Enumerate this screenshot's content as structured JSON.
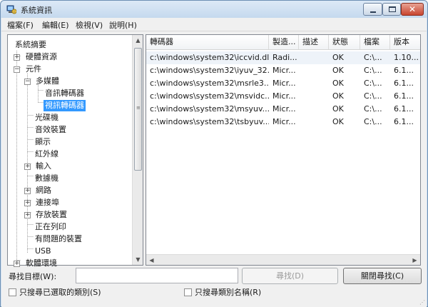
{
  "window": {
    "title": "系統資訊"
  },
  "menu": [
    {
      "label": "檔案(F)"
    },
    {
      "label": "編輯(E)"
    },
    {
      "label": "檢視(V)"
    },
    {
      "label": "說明(H)"
    }
  ],
  "tree": [
    {
      "label": "系統摘要",
      "level": 0,
      "toggle": ""
    },
    {
      "label": "硬體資源",
      "level": 1,
      "toggle": "+"
    },
    {
      "label": "元件",
      "level": 1,
      "toggle": "−"
    },
    {
      "label": "多媒體",
      "level": 2,
      "toggle": "−"
    },
    {
      "label": "音訊轉碼器",
      "level": 3,
      "toggle": ""
    },
    {
      "label": "視訊轉碼器",
      "level": 3,
      "toggle": "",
      "selected": true
    },
    {
      "label": "光碟機",
      "level": 2,
      "toggle": ""
    },
    {
      "label": "音效裝置",
      "level": 2,
      "toggle": ""
    },
    {
      "label": "顯示",
      "level": 2,
      "toggle": ""
    },
    {
      "label": "紅外線",
      "level": 2,
      "toggle": ""
    },
    {
      "label": "輸入",
      "level": 2,
      "toggle": "+"
    },
    {
      "label": "數據機",
      "level": 2,
      "toggle": ""
    },
    {
      "label": "網路",
      "level": 2,
      "toggle": "+"
    },
    {
      "label": "連接埠",
      "level": 2,
      "toggle": "+"
    },
    {
      "label": "存放裝置",
      "level": 2,
      "toggle": "+"
    },
    {
      "label": "正在列印",
      "level": 2,
      "toggle": ""
    },
    {
      "label": "有問題的裝置",
      "level": 2,
      "toggle": ""
    },
    {
      "label": "USB",
      "level": 2,
      "toggle": ""
    },
    {
      "label": "軟體環境",
      "level": 1,
      "toggle": "+"
    }
  ],
  "table": {
    "columns": [
      "轉碼器",
      "製造...",
      "描述",
      "狀態",
      "檔案",
      "版本"
    ],
    "rows": [
      [
        "c:\\windows\\system32\\iccvid.dll",
        "Radi...",
        "",
        "OK",
        "C:\\...",
        "1.10..."
      ],
      [
        "c:\\windows\\system32\\iyuv_32...",
        "Micr...",
        "",
        "OK",
        "C:\\...",
        "6.1..."
      ],
      [
        "c:\\windows\\system32\\msrle3...",
        "Micr...",
        "",
        "OK",
        "C:\\...",
        "6.1..."
      ],
      [
        "c:\\windows\\system32\\msvidc...",
        "Micr...",
        "",
        "OK",
        "C:\\...",
        "6.1..."
      ],
      [
        "c:\\windows\\system32\\msyuv....",
        "Micr...",
        "",
        "OK",
        "C:\\...",
        "6.1..."
      ],
      [
        "c:\\windows\\system32\\tsbyuv....",
        "Micr...",
        "",
        "OK",
        "C:\\...",
        "6.1..."
      ]
    ]
  },
  "find": {
    "label": "尋找目標(W):",
    "value": "",
    "find_button": "尋找(D)",
    "close_button": "關閉尋找(C)",
    "check_selected": "只搜尋已選取的類別(S)",
    "check_category": "只搜尋類別名稱(R)"
  }
}
